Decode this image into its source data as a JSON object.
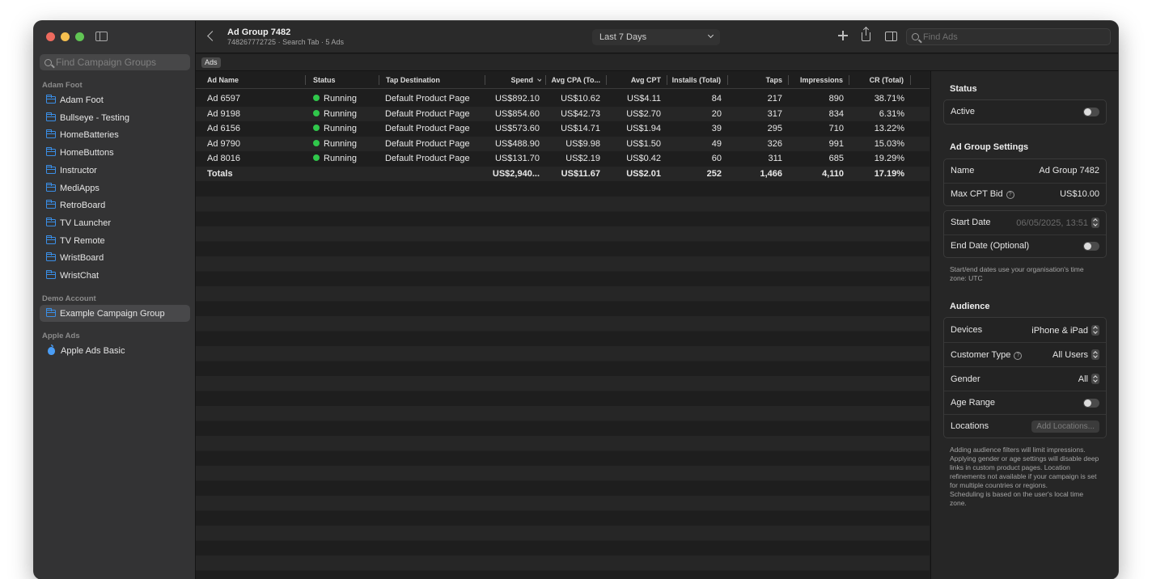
{
  "colors": {
    "close": "#ed6a5e",
    "minimize": "#f5bf4f",
    "zoom": "#61c554",
    "folder": "#3a8ee6",
    "running": "#30c74b"
  },
  "sidebar": {
    "search_placeholder": "Find Campaign Groups",
    "sections": [
      {
        "title": "Adam Foot",
        "items": [
          "Adam Foot",
          "Bullseye - Testing",
          "HomeBatteries",
          "HomeButtons",
          "Instructor",
          "MediApps",
          "RetroBoard",
          "TV Launcher",
          "TV Remote",
          "WristBoard",
          "WristChat"
        ]
      },
      {
        "title": "Demo Account",
        "items": [
          "Example Campaign Group"
        ]
      },
      {
        "title": "Apple Ads",
        "items": [
          "Apple Ads Basic"
        ]
      }
    ]
  },
  "toolbar": {
    "title": "Ad Group 7482",
    "subtitle": "748267772725 · Search Tab · 5 Ads",
    "date_range": "Last 7 Days",
    "search_placeholder": "Find Ads"
  },
  "scope": {
    "chip": "Ads"
  },
  "table": {
    "columns": [
      "Ad Name",
      "Status",
      "Tap Destination",
      "Spend",
      "Avg CPA (To...",
      "Avg CPT",
      "Installs (Total)",
      "Taps",
      "Impressions",
      "CR (Total)"
    ],
    "rows": [
      [
        "Ad 6597",
        "Running",
        "Default Product Page",
        "US$892.10",
        "US$10.62",
        "US$4.11",
        "84",
        "217",
        "890",
        "38.71%"
      ],
      [
        "Ad 9198",
        "Running",
        "Default Product Page",
        "US$854.60",
        "US$42.73",
        "US$2.70",
        "20",
        "317",
        "834",
        "6.31%"
      ],
      [
        "Ad 6156",
        "Running",
        "Default Product Page",
        "US$573.60",
        "US$14.71",
        "US$1.94",
        "39",
        "295",
        "710",
        "13.22%"
      ],
      [
        "Ad 9790",
        "Running",
        "Default Product Page",
        "US$488.90",
        "US$9.98",
        "US$1.50",
        "49",
        "326",
        "991",
        "15.03%"
      ],
      [
        "Ad 8016",
        "Running",
        "Default Product Page",
        "US$131.70",
        "US$2.19",
        "US$0.42",
        "60",
        "311",
        "685",
        "19.29%"
      ]
    ],
    "totals": [
      "Totals",
      "",
      "",
      "US$2,940...",
      "US$11.67",
      "US$2.01",
      "252",
      "1,466",
      "4,110",
      "17.19%"
    ]
  },
  "inspector": {
    "status_heading": "Status",
    "active_label": "Active",
    "settings_heading": "Ad Group Settings",
    "name_label": "Name",
    "name_value": "Ad Group 7482",
    "max_cpt_label": "Max CPT Bid",
    "max_cpt_value": "US$10.00",
    "start_date_label": "Start Date",
    "start_date_value": "06/05/2025, 13:51",
    "end_date_label": "End Date (Optional)",
    "date_note": "Start/end dates use your organisation's time zone: UTC",
    "audience_heading": "Audience",
    "devices_label": "Devices",
    "devices_value": "iPhone & iPad",
    "customer_type_label": "Customer Type",
    "customer_type_value": "All Users",
    "gender_label": "Gender",
    "gender_value": "All",
    "age_range_label": "Age Range",
    "locations_label": "Locations",
    "add_locations": "Add Locations...",
    "audience_note_1": "Adding audience filters will limit impressions. Applying gender or age settings will disable deep links in custom product pages. Location refinements not available if your campaign is set for multiple countries or regions.",
    "audience_note_2": "Scheduling is based on the user's local time zone."
  }
}
